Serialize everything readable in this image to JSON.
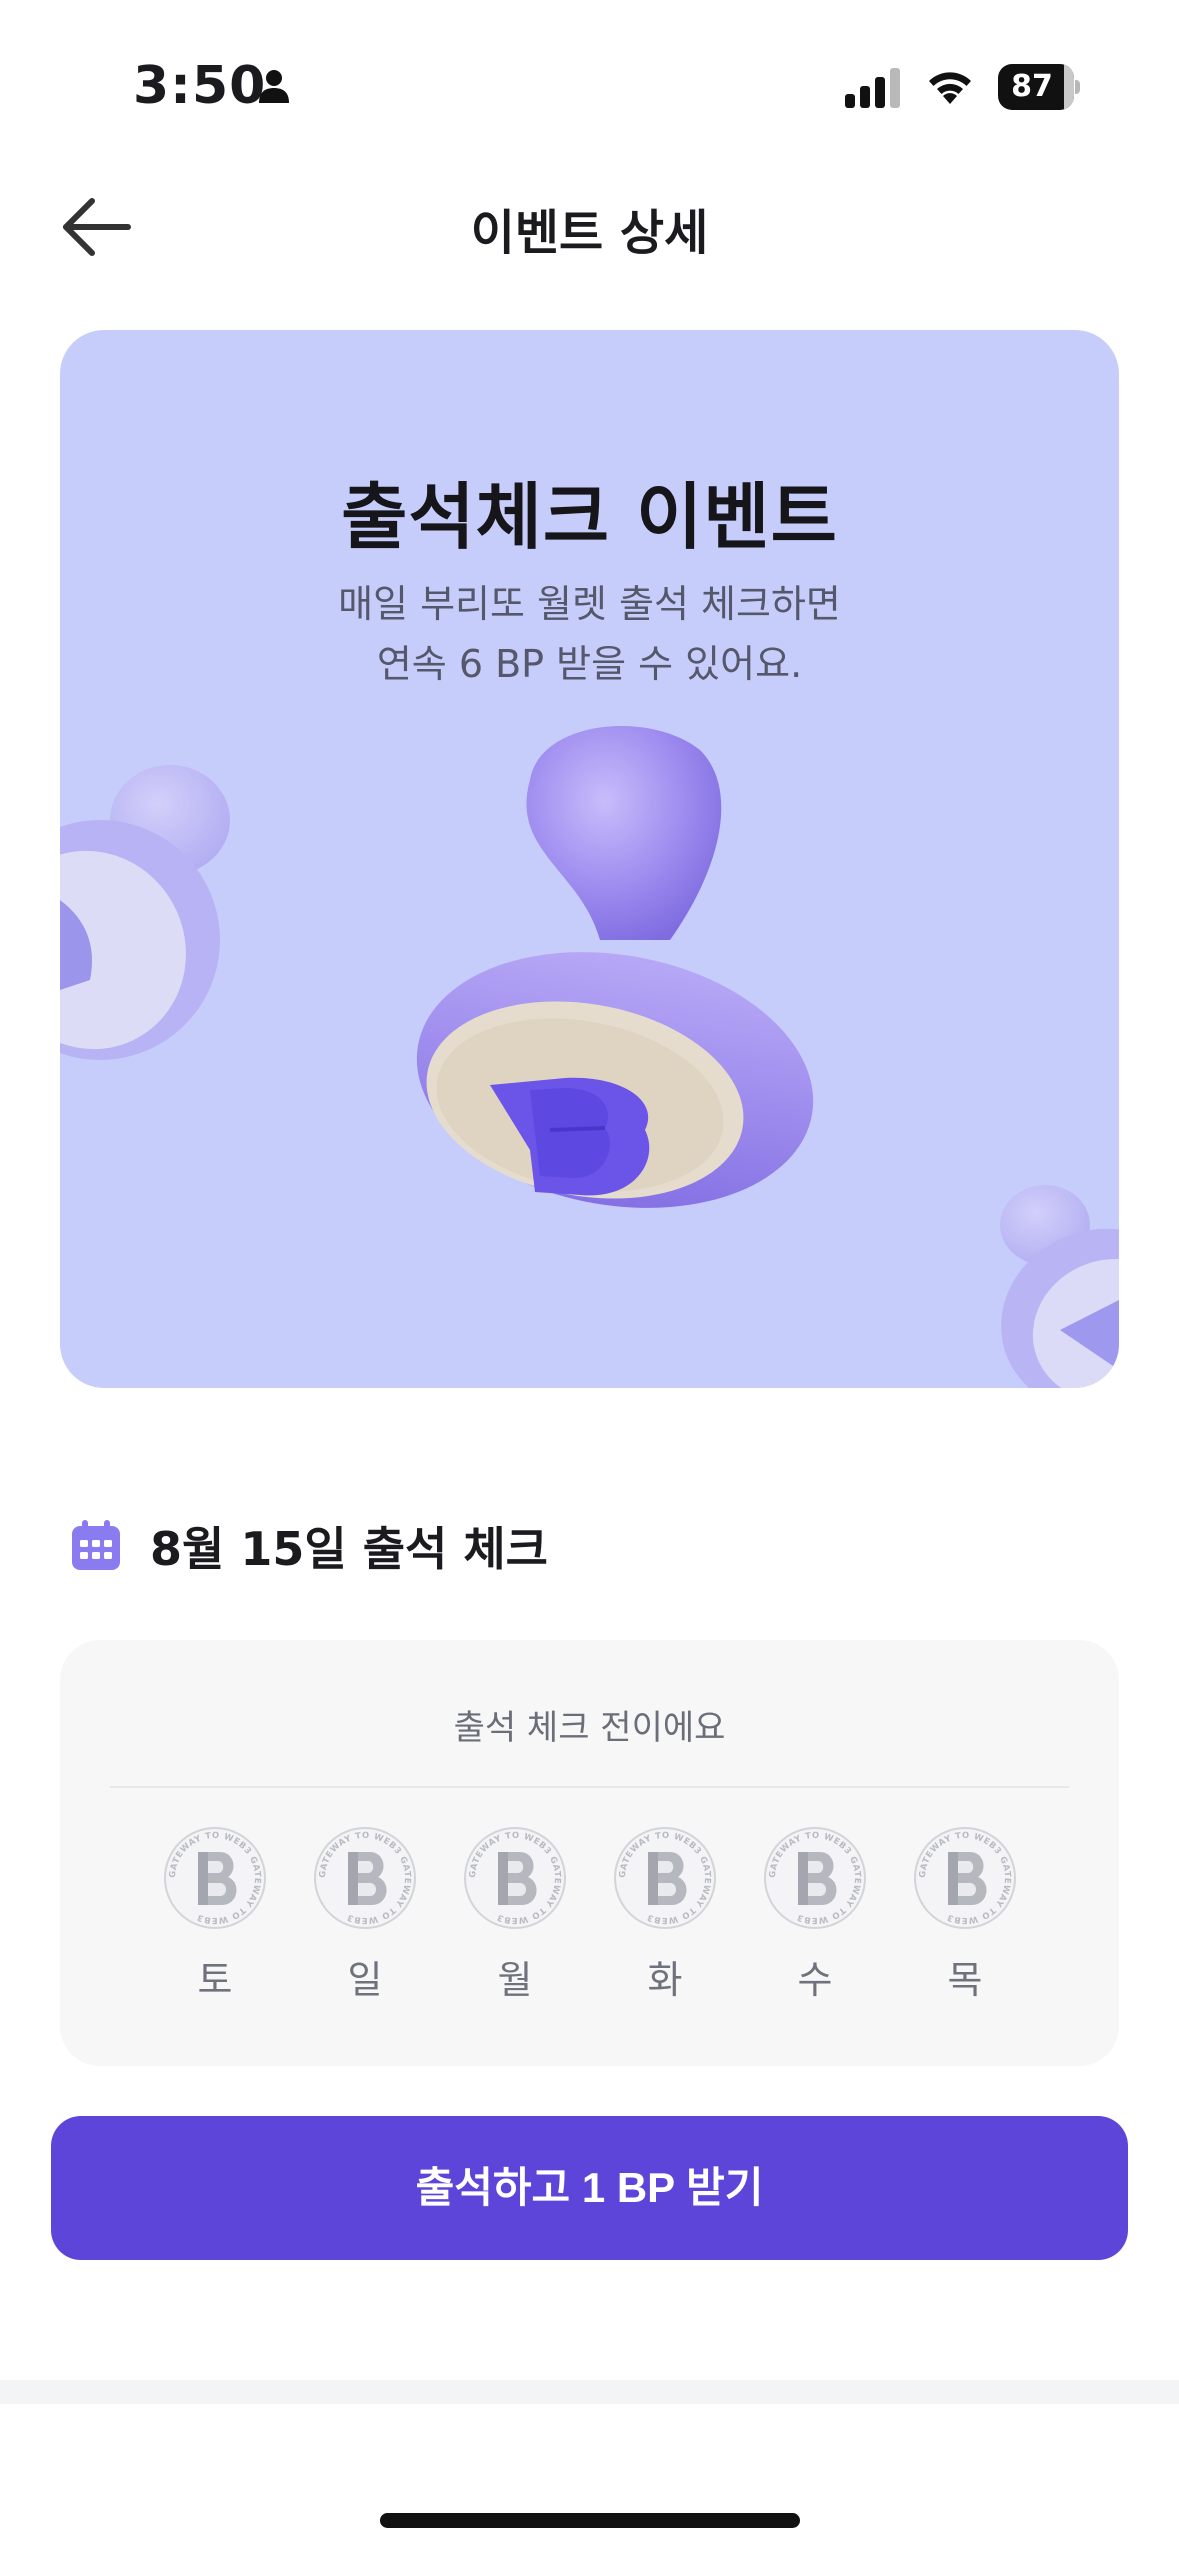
{
  "status_bar": {
    "time": "3:50",
    "battery": "87",
    "icons": [
      "person-icon",
      "cellular-signal-icon",
      "wifi-icon",
      "battery-icon"
    ]
  },
  "header": {
    "title": "이벤트 상세",
    "back_icon": "arrow-left-icon"
  },
  "banner": {
    "title": "출석체크 이벤트",
    "description_line1": "매일 부리또 월렛 출석 체크하면",
    "description_line2": "연속 6 BP 받을 수 있어요.",
    "background_color": "#c7cdfb",
    "illustration": "stamp-illustration"
  },
  "attendance": {
    "heading": "8월 15일 출석 체크",
    "heading_icon": "calendar-icon",
    "status": "출석 체크 전이에요",
    "days": [
      {
        "label": "토",
        "checked": false
      },
      {
        "label": "일",
        "checked": false
      },
      {
        "label": "월",
        "checked": false
      },
      {
        "label": "화",
        "checked": false
      },
      {
        "label": "수",
        "checked": false
      },
      {
        "label": "목",
        "checked": false
      }
    ],
    "badge_text": "GATEWAY TO WEB3 GATEWAY TO WEB3"
  },
  "cta": {
    "label": "출석하고 1 BP 받기",
    "color": "#5d45d9"
  }
}
